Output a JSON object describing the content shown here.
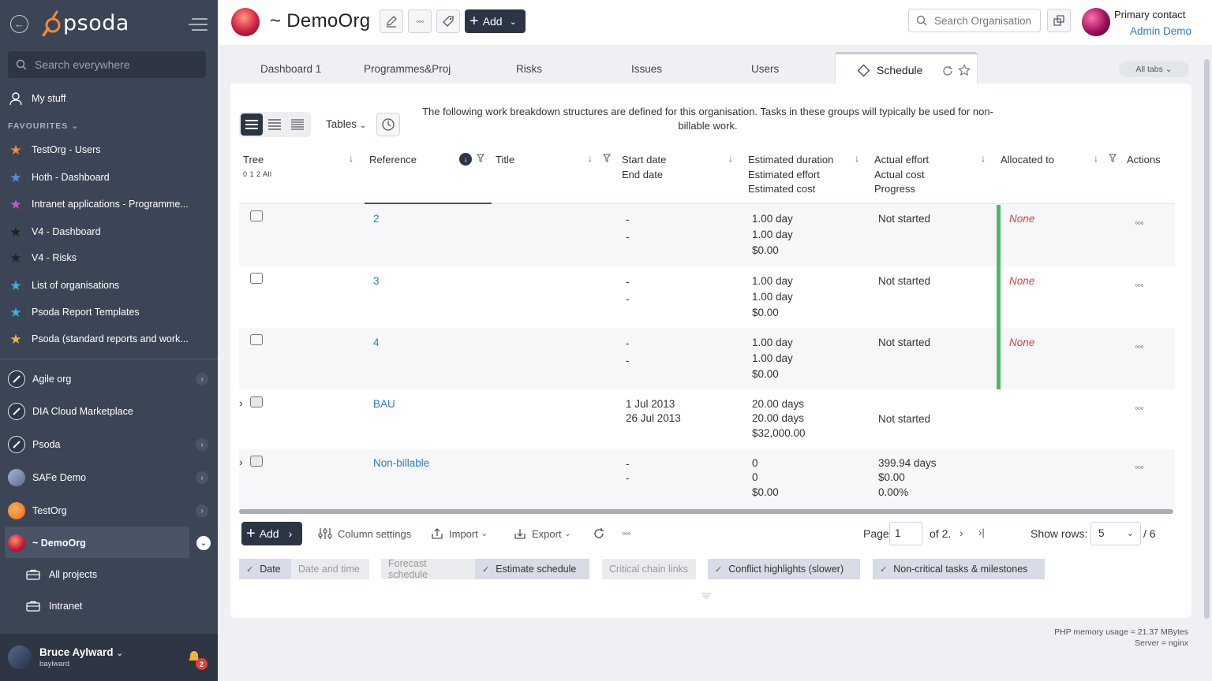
{
  "sidebar": {
    "brand": "psoda",
    "search_placeholder": "Search everywhere",
    "my_stuff": "My stuff",
    "favourites_head": "FAVOURITES",
    "favourites": [
      {
        "label": "TestOrg - Users",
        "color": "#f08a3c"
      },
      {
        "label": "Hoth - Dashboard",
        "color": "#4a90e2"
      },
      {
        "label": "Intranet applications - Programme...",
        "color": "#d84fd0"
      },
      {
        "label": "V4 - Dashboard",
        "color": "#2a2a2a"
      },
      {
        "label": "V4 - Risks",
        "color": "#2a2a2a"
      },
      {
        "label": "List of organisations",
        "color": "#3ab0e0"
      },
      {
        "label": "Psoda Report Templates",
        "color": "#3ab0e0"
      },
      {
        "label": "Psoda (standard reports and work...",
        "color": "#f0b43c"
      }
    ],
    "orgs": [
      {
        "label": "Agile org"
      },
      {
        "label": "DIA Cloud Marketplace"
      },
      {
        "label": "Psoda"
      },
      {
        "label": "SAFe Demo"
      },
      {
        "label": "TestOrg"
      },
      {
        "label": "~ DemoOrg"
      }
    ],
    "sub_items": [
      {
        "label": "All projects"
      },
      {
        "label": "Intranet"
      }
    ],
    "user": {
      "name": "Bruce Aylward",
      "username": "baylward",
      "notifications": "2"
    }
  },
  "topbar": {
    "org_title": "~ DemoOrg",
    "add_label": "Add",
    "search_placeholder": "Search Organisation",
    "contact_role": "Primary contact",
    "contact_name": "Admin Demo"
  },
  "tabs": {
    "items": [
      "Dashboard 1",
      "Programmes&Proj",
      "Risks",
      "Issues",
      "Users"
    ],
    "active": "Schedule",
    "all_tabs": "All tabs"
  },
  "toolbar": {
    "tables_label": "Tables",
    "intro": "The following work breakdown structures are defined for this organisation. Tasks in these groups will typically be used for non-billable work."
  },
  "table": {
    "headers": {
      "tree": "Tree",
      "tree_levels": "0 1 2 All",
      "reference": "Reference",
      "title": "Title",
      "dates": [
        "Start date",
        "End date"
      ],
      "estimates": [
        "Estimated duration",
        "Estimated effort",
        "Estimated cost"
      ],
      "actuals": [
        "Actual effort",
        "Actual cost",
        "Progress"
      ],
      "allocated": "Allocated to",
      "actions": "Actions"
    },
    "rows": [
      {
        "ref": "2",
        "start": "-",
        "end": "-",
        "est": [
          "1.00 day",
          "1.00 day",
          "$0.00"
        ],
        "actual": [
          "Not started"
        ],
        "allocated": "None"
      },
      {
        "ref": "3",
        "start": "-",
        "end": "-",
        "est": [
          "1.00 day",
          "1.00 day",
          "$0.00"
        ],
        "actual": [
          "Not started"
        ],
        "allocated": "None"
      },
      {
        "ref": "4",
        "start": "-",
        "end": "-",
        "est": [
          "1.00 day",
          "1.00 day",
          "$0.00"
        ],
        "actual": [
          "Not started"
        ],
        "allocated": "None"
      },
      {
        "ref": "BAU",
        "start": "1 Jul 2013",
        "end": "26 Jul 2013",
        "est": [
          "20.00 days",
          "20.00 days",
          "$32,000.00"
        ],
        "actual": [
          "Not started"
        ],
        "allocated": ""
      },
      {
        "ref": "Non-billable",
        "start": "-",
        "end": "-",
        "est": [
          "0",
          "0",
          "$0.00"
        ],
        "actual": [
          "399.94 days",
          "$0.00",
          "0.00%"
        ],
        "allocated": ""
      }
    ]
  },
  "footer": {
    "add_label": "Add",
    "column_settings": "Column settings",
    "import": "Import",
    "export": "Export",
    "page_label": "Page",
    "page_value": "1",
    "of_label": "of 2.",
    "show_rows_label": "Show rows:",
    "rows_value": "5",
    "rows_total": "/ 6"
  },
  "chips": {
    "date": "Date",
    "date_time": "Date and time",
    "forecast": "Forecast schedule",
    "estimate": "Estimate schedule",
    "critical": "Critical chain links",
    "conflict": "Conflict highlights (slower)",
    "noncritical": "Non-critical tasks & milestones"
  },
  "server": {
    "memory": "PHP memory usage = 21.37 MBytes",
    "server": "Server = nginx"
  }
}
